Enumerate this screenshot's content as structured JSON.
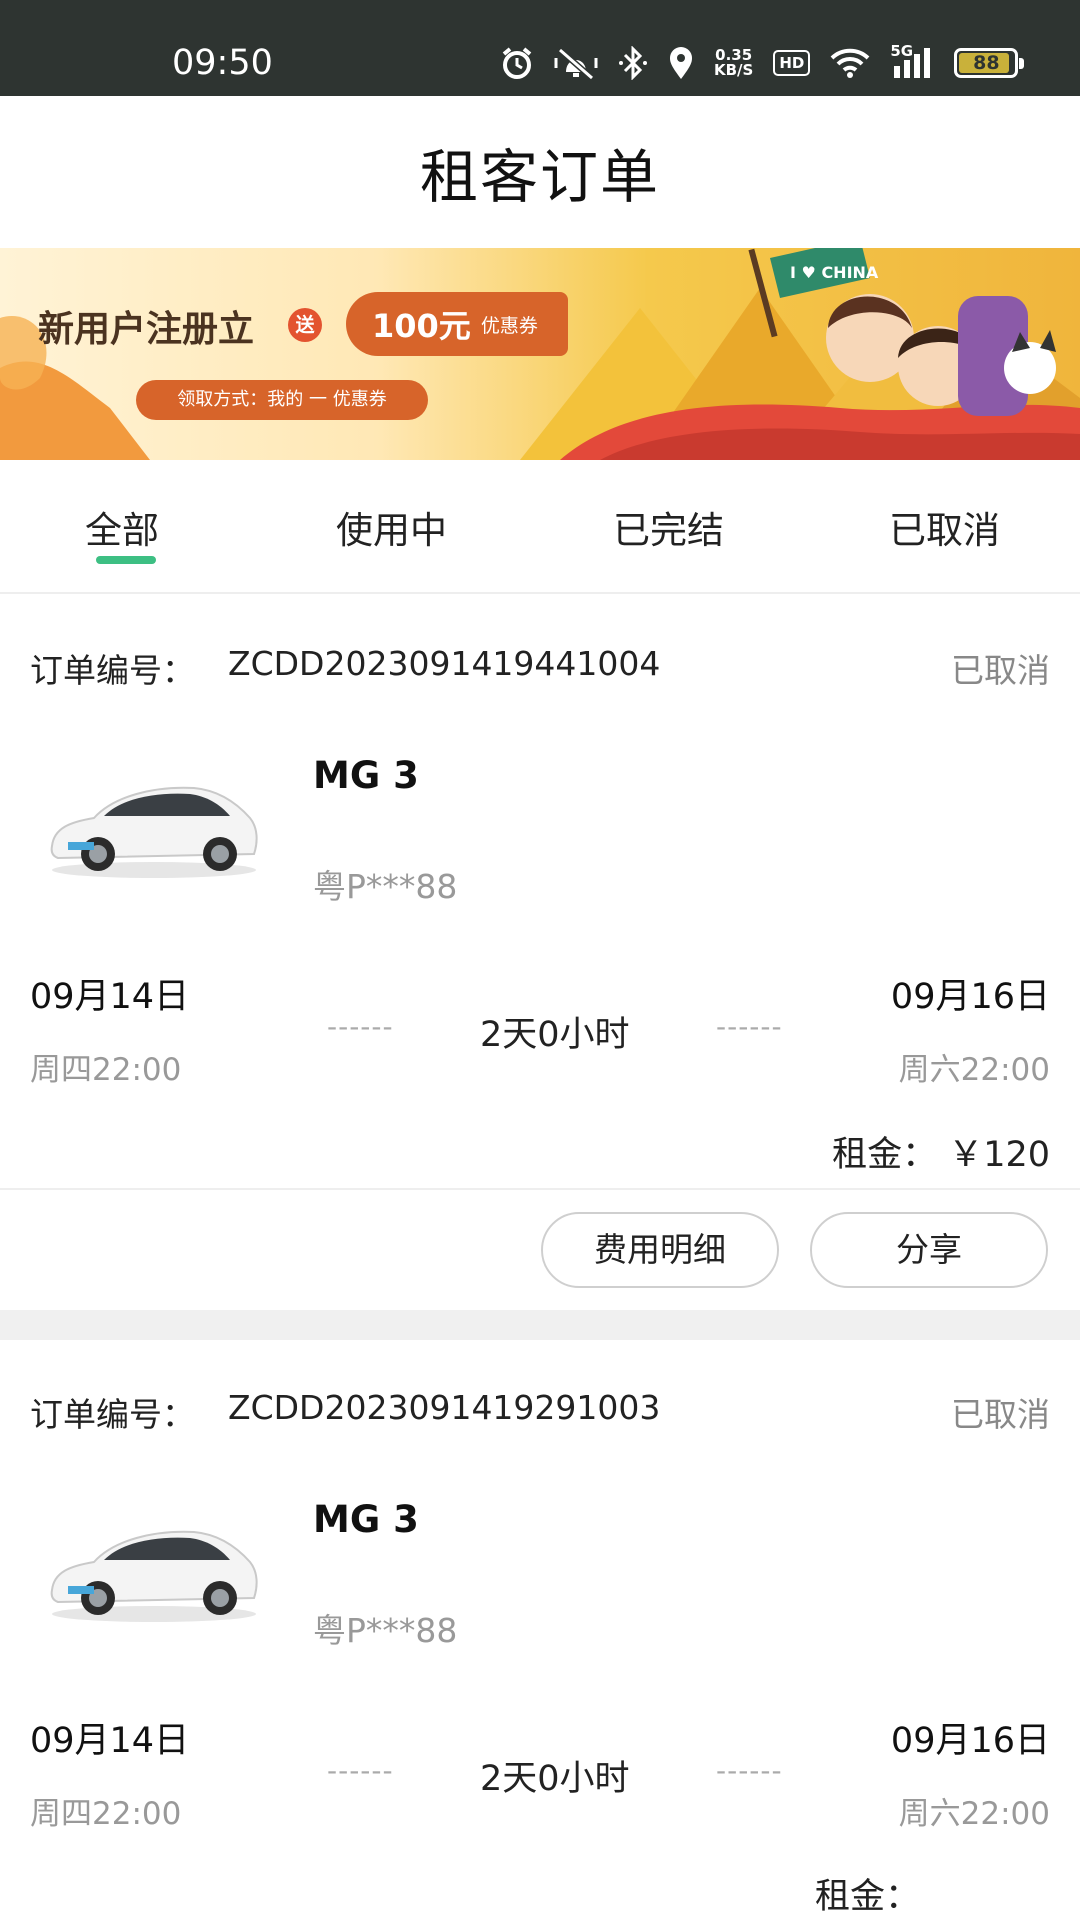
{
  "status_bar": {
    "time": "09:50",
    "speed_value": "0.35",
    "speed_unit": "KB/S",
    "hd": "HD",
    "network": "5G",
    "battery": "88"
  },
  "header": {
    "title": "租客订单"
  },
  "banner": {
    "headline": "新用户注册立",
    "send_badge": "送",
    "amount": "100元",
    "amount_suffix": "优惠券",
    "claim_method": "领取方式：我的 一 优惠券",
    "flag_text": "I ♥ CHINA"
  },
  "tabs": [
    {
      "label": "全部",
      "active": true
    },
    {
      "label": "使用中",
      "active": false
    },
    {
      "label": "已完结",
      "active": false
    },
    {
      "label": "已取消",
      "active": false
    }
  ],
  "orders": [
    {
      "order_label": "订单编号：",
      "order_no": "ZCDD2023091419441004",
      "status": "已取消",
      "car_name": "MG 3",
      "plate": "粤P***88",
      "start_date": "09月14日",
      "start_weekday": "周四22:00",
      "end_date": "09月16日",
      "end_weekday": "周六22:00",
      "duration": "2天0小时",
      "dash": "------",
      "rent": "租金： ￥120",
      "btn_fee": "费用明细",
      "btn_share": "分享"
    },
    {
      "order_label": "订单编号：",
      "order_no": "ZCDD2023091419291003",
      "status": "已取消",
      "car_name": "MG 3",
      "plate": "粤P***88",
      "start_date": "09月14日",
      "start_weekday": "周四22:00",
      "end_date": "09月16日",
      "end_weekday": "周六22:00",
      "duration": "2天0小时",
      "dash": "------",
      "rent": "租金："
    }
  ],
  "colors": {
    "accent": "#3dbf83",
    "status_bar": "#2e3431",
    "muted": "#999999",
    "banner_orange": "#d7642a"
  }
}
